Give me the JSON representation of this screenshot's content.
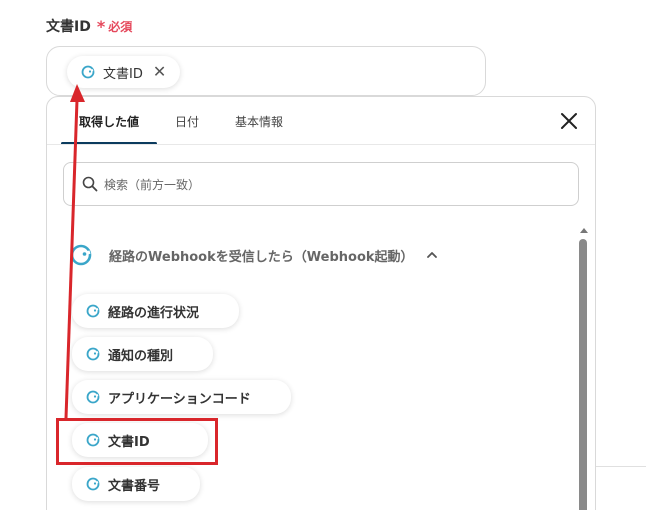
{
  "field": {
    "label": "文書ID",
    "required_star": "*",
    "required_text": "必須",
    "selected_chip": {
      "label": "文書ID",
      "remove_glyph": "✕"
    }
  },
  "panel": {
    "tabs": [
      {
        "label": "取得した値",
        "active": true
      },
      {
        "label": "日付",
        "active": false
      },
      {
        "label": "基本情報",
        "active": false
      }
    ],
    "close_glyph": "close-icon",
    "search": {
      "placeholder": "検索（前方一致）"
    },
    "group": {
      "label": "経路のWebhookを受信したら（Webhook起動）",
      "expanded": true
    },
    "items": [
      {
        "label": "経路の進行状況"
      },
      {
        "label": "通知の種別"
      },
      {
        "label": "アプリケーションコード"
      },
      {
        "label": "文書ID"
      },
      {
        "label": "文書番号"
      }
    ]
  },
  "annotation": {
    "highlight_color": "#d9262b",
    "highlighted_item": "文書ID"
  },
  "colors": {
    "accent": "#0b3b5e",
    "required": "#e5485c",
    "icon": "#3aa6c9"
  }
}
